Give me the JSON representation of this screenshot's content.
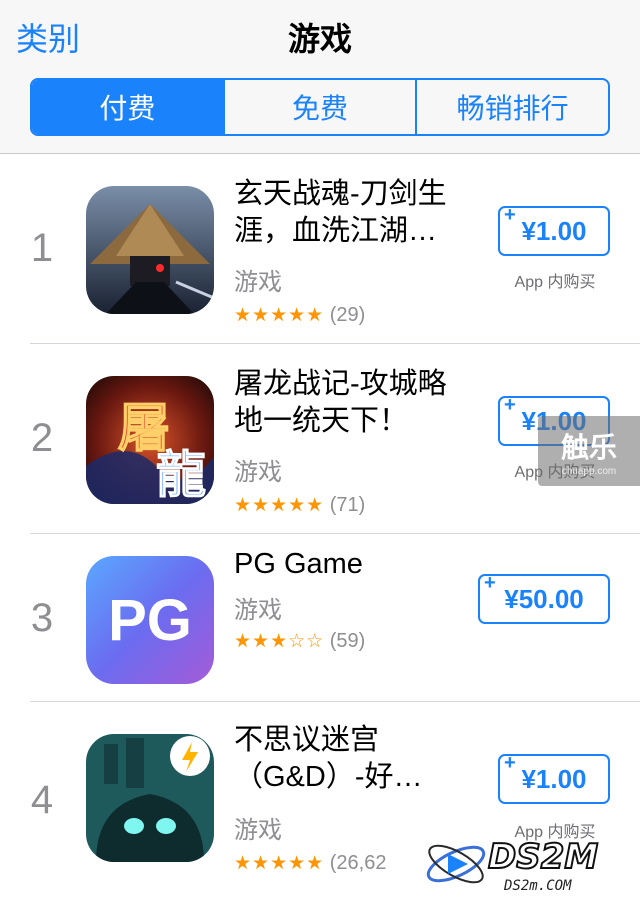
{
  "nav": {
    "back_label": "类别",
    "title": "游戏"
  },
  "tabs": [
    {
      "label": "付费",
      "active": true
    },
    {
      "label": "免费",
      "active": false
    },
    {
      "label": "畅销排行",
      "active": false
    }
  ],
  "apps": [
    {
      "rank": "1",
      "name": "玄天战魂-刀剑生涯，血洗江湖…",
      "category": "游戏",
      "stars": "★★★★★",
      "stars_value": 5,
      "count": "(29)",
      "price": "¥1.00",
      "iap": "App 内购买"
    },
    {
      "rank": "2",
      "name": "屠龙战记-攻城略地一统天下！",
      "category": "游戏",
      "stars": "★★★★★",
      "stars_value": 5,
      "count": "(71)",
      "price": "¥1.00",
      "iap": "App 内购买"
    },
    {
      "rank": "3",
      "name": "PG Game",
      "category": "游戏",
      "stars": "★★★☆☆",
      "stars_value": 3,
      "count": "(59)",
      "price": "¥50.00",
      "iap": "",
      "icon_text": "PG"
    },
    {
      "rank": "4",
      "name": "不思议迷宫（G&D）-好…",
      "category": "游戏",
      "stars": "★★★★★",
      "stars_value": 5,
      "count": "(26,62",
      "price": "¥1.00",
      "iap": "App 内购买"
    }
  ],
  "icon2_text": "屠龍",
  "watermarks": {
    "chule": "触乐",
    "chule_sub": "chuapp.com",
    "ds2m": "DS2M",
    "ds2m_sub": "DS2m.COM"
  },
  "colors": {
    "accent": "#1a82fb",
    "star": "#ff9500",
    "secondary_text": "#8e8e93"
  }
}
